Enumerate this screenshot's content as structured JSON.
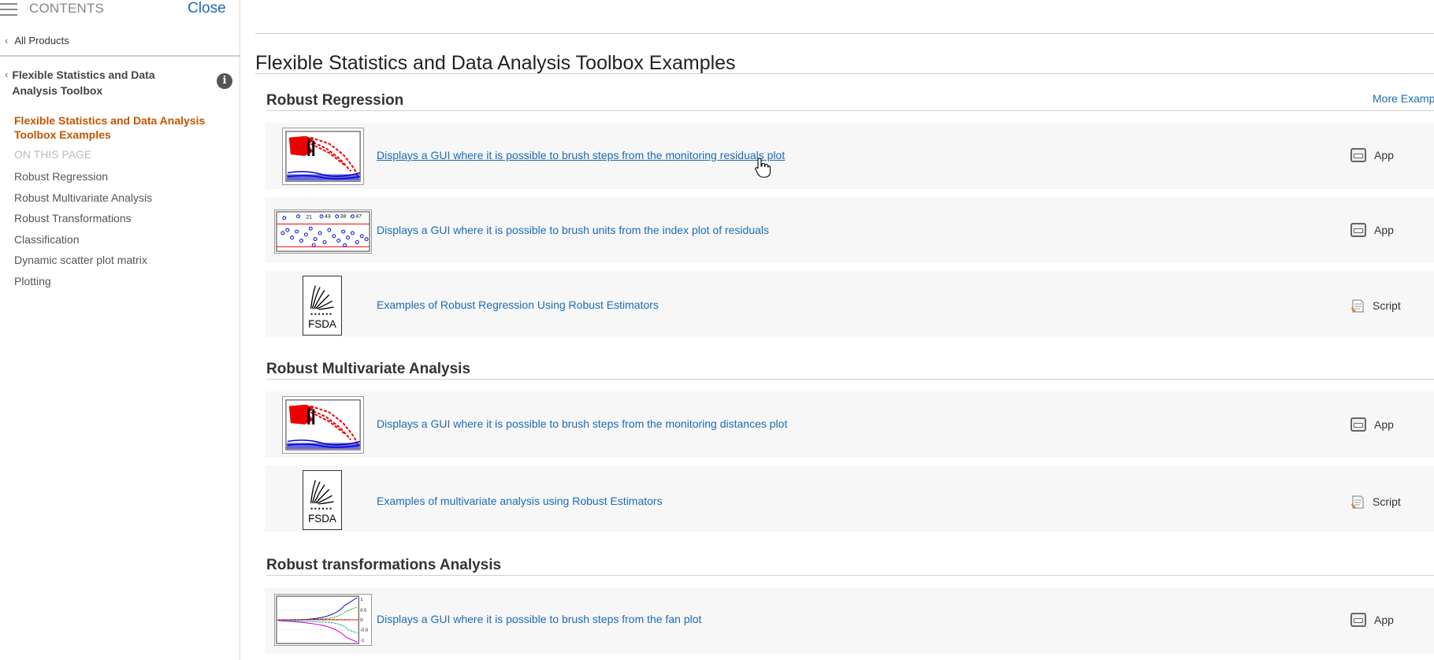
{
  "sidebar": {
    "contents_label": "CONTENTS",
    "close_label": "Close",
    "all_products": "All Products",
    "toolbox_title": "Flexible Statistics and Data Analysis Toolbox",
    "info_icon": "i",
    "current_page": "Flexible Statistics and Data Analysis Toolbox Examples",
    "on_this_page": "ON THIS PAGE",
    "toc": [
      "Robust Regression",
      "Robust Multivariate Analysis",
      "Robust Transformations",
      "Classification",
      "Dynamic scatter plot matrix",
      "Plotting"
    ]
  },
  "main": {
    "title": "Flexible Statistics and Data Analysis Toolbox Examples",
    "more_examples": "More Examp",
    "sections": [
      {
        "heading": "Robust Regression",
        "items": [
          {
            "link": "Displays a GUI where it is possible to brush steps from the monitoring residuals plot",
            "type": "App",
            "thumb": "monitoring-plot"
          },
          {
            "link": "Displays a GUI where it is possible to brush units from the index plot of residuals",
            "type": "App",
            "thumb": "index-plot"
          },
          {
            "link": "Examples of Robust Regression Using Robust Estimators",
            "type": "Script",
            "thumb": "fsda-logo"
          }
        ]
      },
      {
        "heading": "Robust Multivariate Analysis",
        "items": [
          {
            "link": "Displays a GUI where it is possible to brush steps from the monitoring distances plot",
            "type": "App",
            "thumb": "monitoring-plot"
          },
          {
            "link": "Examples of multivariate analysis using Robust Estimators",
            "type": "Script",
            "thumb": "fsda-logo"
          }
        ]
      },
      {
        "heading": "Robust transformations Analysis",
        "items": [
          {
            "link": "Displays a GUI where it is possible to brush steps from the fan plot",
            "type": "App",
            "thumb": "fan-plot"
          }
        ]
      }
    ],
    "logo_text": "FSDA",
    "index_plot_labels": [
      "21",
      "43",
      "38",
      "47"
    ],
    "fan_plot_labels": [
      "1",
      "0.5",
      "0",
      "-0.5",
      "-1"
    ]
  },
  "icons": {
    "menu": "hamburger-icon",
    "back": "chevron-left-icon",
    "info": "info-icon",
    "app": "app-icon",
    "script": "script-icon",
    "cursor": "hand-pointer-cursor"
  },
  "colors": {
    "link": "#1a6bb8",
    "active": "#c45400",
    "card_bg": "#f7f7f7"
  }
}
